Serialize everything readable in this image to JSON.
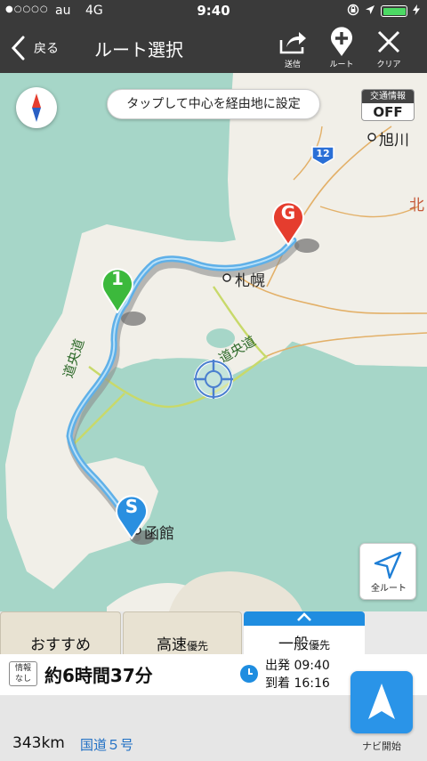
{
  "status_bar": {
    "signal": "●○○○○",
    "carrier": "au",
    "network": "4G",
    "time": "9:40"
  },
  "header": {
    "back_label": "戻る",
    "title": "ルート選択",
    "buttons": {
      "send": "送信",
      "route": "ルート",
      "clear": "クリア"
    }
  },
  "map": {
    "tooltip": "タップして中心を経由地に設定",
    "traffic": {
      "title": "交通情報",
      "state": "OFF"
    },
    "places": {
      "asahikawa": "旭川",
      "sapporo": "札幌",
      "hakodate": "函館",
      "north_partial": "北"
    },
    "road_shield": "12",
    "road_labels": {
      "left": "道央道",
      "center": "道央道"
    },
    "markers": {
      "start": "S",
      "goal": "G",
      "waypoint": "1"
    },
    "all_route_label": "全ルート"
  },
  "tabs": [
    {
      "label": "おすすめ",
      "suffix": ""
    },
    {
      "label": "高速",
      "suffix": "優先"
    },
    {
      "label": "一般",
      "suffix": "優先"
    }
  ],
  "summary": {
    "info_tag": "情報なし",
    "info_tag_line1": "情報",
    "info_tag_line2": "なし",
    "duration": "約6時間37分",
    "departure_label": "出発",
    "departure_time": "09:40",
    "arrival_label": "到着",
    "arrival_time": "16:16",
    "distance": "343km",
    "road": "国道５号"
  },
  "nav_start_label": "ナビ開始",
  "colors": {
    "header_bg": "#3a3a3a",
    "sea": "#a6d6c8",
    "land": "#f1efe8",
    "route": "#5fb0e8",
    "accent": "#1f8de0",
    "start_marker": "#2a8fe0",
    "goal_marker": "#e53d2e",
    "waypoint_marker": "#3cb93c"
  }
}
